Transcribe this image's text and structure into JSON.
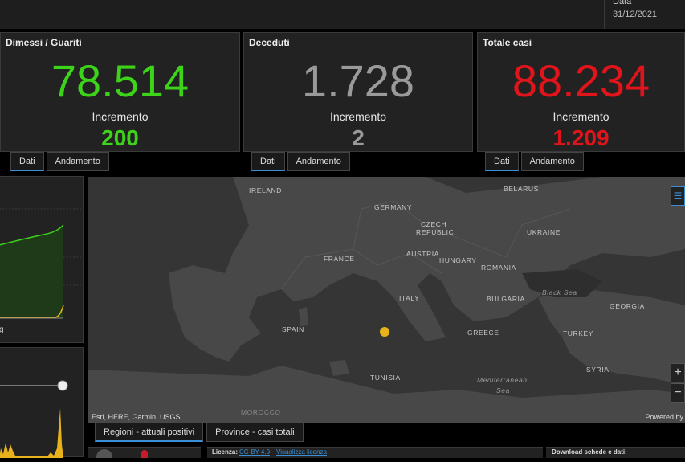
{
  "header": {
    "date_label": "Data",
    "date_value": "31/12/2021"
  },
  "cards": [
    {
      "title": "Dimessi / Guariti",
      "value": "78.514",
      "increment_label": "Incremento",
      "increment_value": "200",
      "color": "#3ed31b"
    },
    {
      "title": "Deceduti",
      "value": "1.728",
      "increment_label": "Incremento",
      "increment_value": "2",
      "color": "#9a9a9a"
    },
    {
      "title": "Totale casi",
      "value": "88.234",
      "increment_label": "Incremento",
      "increment_value": "1.209",
      "color": "#e0141b"
    }
  ],
  "card_tabs": {
    "dati": "Dati",
    "andamento": "Andamento"
  },
  "left_panel": {
    "partial_label": "g"
  },
  "map": {
    "labels": {
      "ireland": "IRELAND",
      "belarus": "BELARUS",
      "germany": "GERMANY",
      "czech": "CZECH",
      "republic": "REPUBLIC",
      "ukraine": "UKRAINE",
      "austria": "AUSTRIA",
      "hungary": "HUNGARY",
      "france": "FRANCE",
      "romania": "ROMANIA",
      "italy": "ITALY",
      "bulgaria": "BULGARIA",
      "black_sea": "Black Sea",
      "georgia": "GEORGIA",
      "spain": "SPAIN",
      "greece": "GREECE",
      "turkey": "TURKEY",
      "tunisia": "TUNISIA",
      "syria": "SYRIA",
      "mediterranean": "Mediterranean",
      "sea": "Sea",
      "morocco": "MOROCCO"
    },
    "attribution": "Esri, HERE, Garmin, USGS",
    "powered_by": "Powered by",
    "zoom_in": "+",
    "zoom_out": "−",
    "legend_icon": "☰",
    "marker_color": "#e8b21a"
  },
  "bottom_tabs": {
    "regioni": "Regioni - attuali positivi",
    "province": "Province - casi totali"
  },
  "footer": {
    "license_label": "Licenza:",
    "license_link": "CC-BY-4.0",
    "sep": " - ",
    "view_license": "Visualizza licenza",
    "download": "Download schede e dati:"
  },
  "slider": {
    "handle_icon": "circle-handle"
  }
}
